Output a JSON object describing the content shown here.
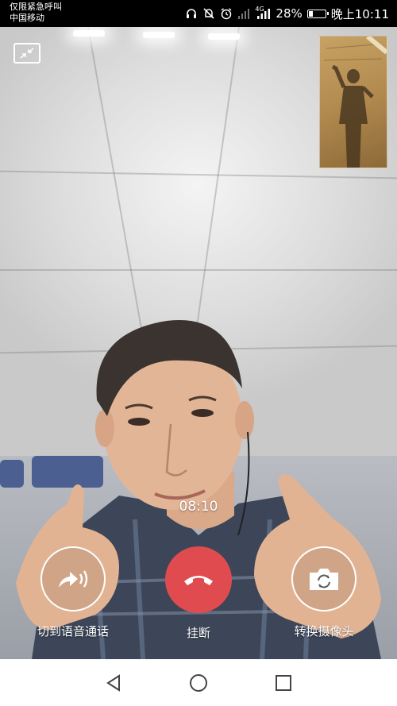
{
  "status_bar": {
    "carrier_line1": "仅限紧急呼叫",
    "carrier_line2": "中国移动",
    "network": "4G",
    "battery": "28%",
    "battery_level": 0.28,
    "time": "晚上10:11",
    "icons": [
      "headset-icon",
      "mute-icon",
      "alarm-icon",
      "signal-icon",
      "signal-4g-icon",
      "battery-icon"
    ]
  },
  "call": {
    "duration": "08:10"
  },
  "controls": {
    "switch_voice_label": "切到语音通话",
    "hangup_label": "挂断",
    "switch_camera_label": "转换摄像头",
    "hangup_color": "#e04b4f"
  },
  "nav": {
    "icons": [
      "back-icon",
      "home-icon",
      "recents-icon"
    ]
  }
}
